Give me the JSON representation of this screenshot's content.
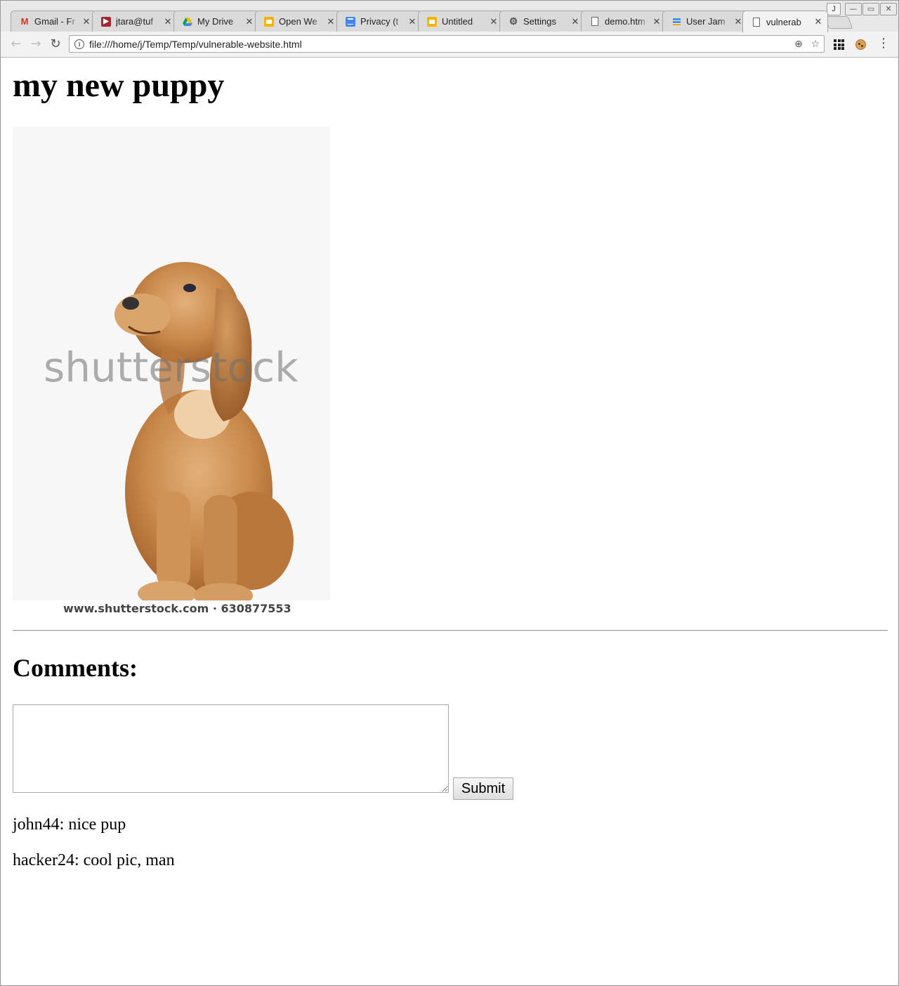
{
  "browser": {
    "tabs": [
      {
        "label": "Gmail - Fr",
        "icon": "gmail-icon",
        "active": false
      },
      {
        "label": "jtara@tuf",
        "icon": "mail-icon",
        "active": false
      },
      {
        "label": "My Drive",
        "icon": "google-drive-icon",
        "active": false
      },
      {
        "label": "Open We",
        "icon": "slides-icon",
        "active": false
      },
      {
        "label": "Privacy (t",
        "icon": "docs-icon",
        "active": false
      },
      {
        "label": "Untitled",
        "icon": "slides-icon",
        "active": false
      },
      {
        "label": "Settings",
        "icon": "gear-icon",
        "active": false
      },
      {
        "label": "demo.htm",
        "icon": "page-icon",
        "active": false
      },
      {
        "label": "User Jam",
        "icon": "stack-icon",
        "active": false
      },
      {
        "label": "vulnerab",
        "icon": "page-icon",
        "active": true
      }
    ],
    "tab_close_glyph": "✕",
    "profile_initial": "J",
    "url": "file:///home/j/Temp/Temp/vulnerable-website.html"
  },
  "page": {
    "title": "my new puppy",
    "image": {
      "watermark": "shutterstock",
      "footer": "www.shutterstock.com · 630877553"
    },
    "comments_heading": "Comments:",
    "comment_input": {
      "value": "",
      "placeholder": ""
    },
    "submit_label": "Submit",
    "comments": [
      {
        "text": "john44: nice pup"
      },
      {
        "text": "hacker24: cool pic, man"
      }
    ]
  }
}
